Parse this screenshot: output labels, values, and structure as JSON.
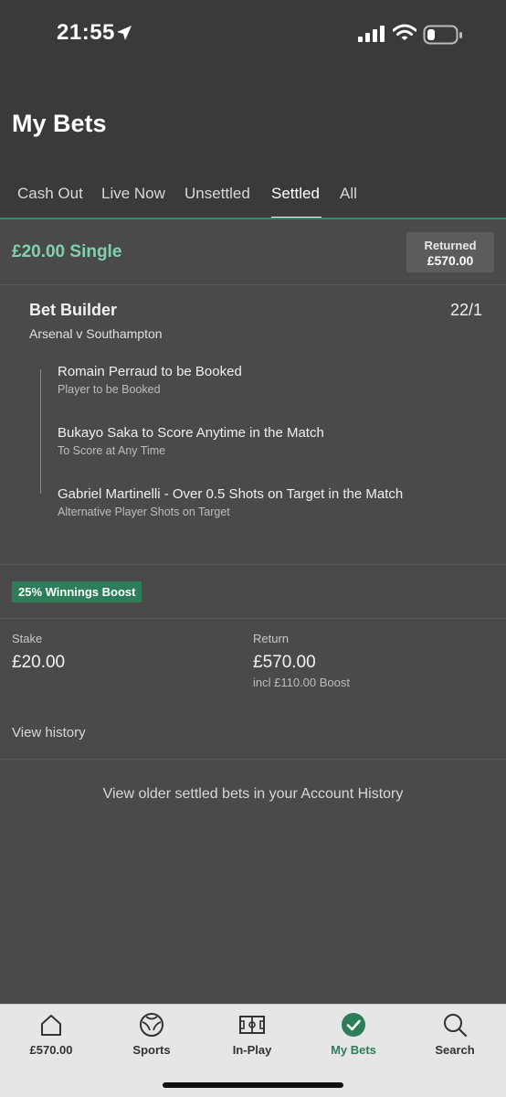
{
  "status_bar": {
    "time": "21:55",
    "icons": [
      "location-arrow-icon",
      "signal-icon",
      "wifi-icon",
      "battery-icon"
    ]
  },
  "header": {
    "title": "My Bets",
    "tabs": [
      {
        "label": "Cash Out"
      },
      {
        "label": "Live Now"
      },
      {
        "label": "Unsettled"
      },
      {
        "label": "Settled"
      },
      {
        "label": "All"
      }
    ],
    "active_tab": "Settled"
  },
  "bet": {
    "title": "£20.00 Single",
    "returned_label": "Returned",
    "returned_amount": "£570.00",
    "builder_title": "Bet Builder",
    "odds": "22/1",
    "match": "Arsenal v Southampton",
    "legs": [
      {
        "name": "Romain Perraud to be Booked",
        "market": "Player to be Booked"
      },
      {
        "name": "Bukayo Saka to Score Anytime in the Match",
        "market": "To Score at Any Time"
      },
      {
        "name": "Gabriel Martinelli - Over 0.5 Shots on Target in the Match",
        "market": "Alternative Player Shots on Target"
      }
    ],
    "boost_badge": "25% Winnings Boost",
    "stake_label": "Stake",
    "stake_value": "£20.00",
    "return_label": "Return",
    "return_value": "£570.00",
    "return_boost": "incl £110.00 Boost",
    "view_history": "View history"
  },
  "older_bets_text": "View older settled bets in your Account History",
  "bottom_nav": {
    "items": [
      {
        "label": "£570.00",
        "icon": "home-icon"
      },
      {
        "label": "Sports",
        "icon": "football-icon"
      },
      {
        "label": "In-Play",
        "icon": "pitch-icon"
      },
      {
        "label": "My Bets",
        "icon": "check-circle-icon"
      },
      {
        "label": "Search",
        "icon": "search-icon"
      }
    ],
    "active": "My Bets"
  },
  "colors": {
    "accent_green": "#7ed3ae",
    "badge_green": "#2e7d5a",
    "background": "#4a4a4a",
    "header_background": "#3a3a3a"
  }
}
